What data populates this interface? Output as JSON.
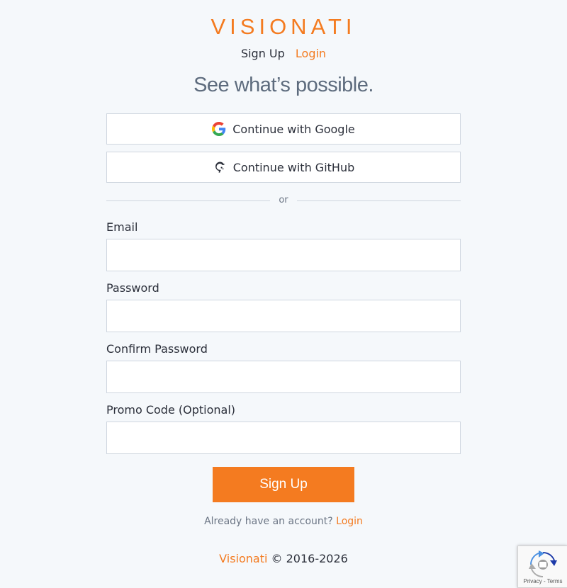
{
  "brand": {
    "logo_text": "VISIONATI",
    "accent_color": "#f47b20"
  },
  "top_nav": {
    "signup_label": "Sign Up",
    "login_label": "Login"
  },
  "tagline": "See what’s possible.",
  "oauth": {
    "google": {
      "label": "Continue with Google",
      "icon": "google-icon"
    },
    "github": {
      "label": "Continue with GitHub",
      "icon": "github-icon"
    }
  },
  "divider_text": "or",
  "form": {
    "fields": [
      {
        "label": "Email",
        "value": "",
        "placeholder": ""
      },
      {
        "label": "Password",
        "value": "",
        "placeholder": ""
      },
      {
        "label": "Confirm Password",
        "value": "",
        "placeholder": ""
      },
      {
        "label": "Promo Code (Optional)",
        "value": "",
        "placeholder": ""
      }
    ],
    "submit_label": "Sign Up"
  },
  "account_prompt": {
    "text": "Already have an account?",
    "link": "Login"
  },
  "footer": {
    "brand": "Visionati",
    "copyright": "© 2016-2026"
  },
  "recaptcha": {
    "text": "Privacy - Terms",
    "icon": "recaptcha-icon"
  }
}
